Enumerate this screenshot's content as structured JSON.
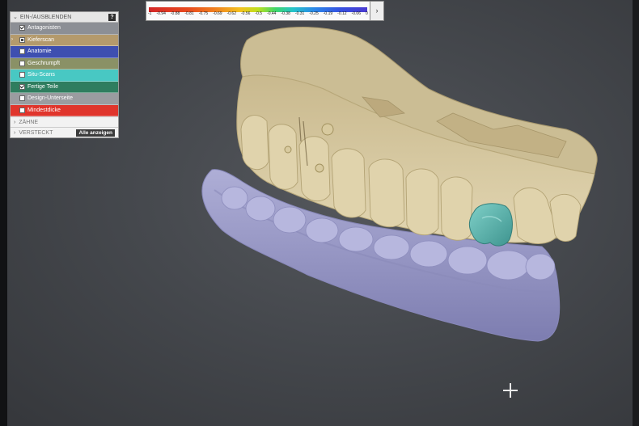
{
  "panel": {
    "title": "EIN-/AUSBLENDEN",
    "help": "?",
    "layers": [
      {
        "label": "Antagonisten",
        "color": "#8c8f95",
        "state": "checked",
        "expandable": false
      },
      {
        "label": "Kieferscan",
        "color": "#b49a6c",
        "state": "partial",
        "expandable": true
      },
      {
        "label": "Anatomie",
        "color": "#3e4fb0",
        "state": "unchecked",
        "expandable": false
      },
      {
        "label": "Geschrumpft",
        "color": "#8a9166",
        "state": "unchecked",
        "expandable": false
      },
      {
        "label": "Situ-Scans",
        "color": "#48c8c3",
        "state": "unchecked",
        "expandable": false
      },
      {
        "label": "Fertige Teile",
        "color": "#2f7d5f",
        "state": "checked",
        "expandable": false
      },
      {
        "label": "Design-Unterseite",
        "color": "#9a9ca0",
        "state": "unchecked",
        "expandable": false
      },
      {
        "label": "Mindestdicke",
        "color": "#e0352c",
        "state": "unchecked",
        "expandable": false
      }
    ],
    "teeth_section": "ZÄHNE",
    "hidden_section": "VERSTECKT",
    "show_all": "Alle anzeigen"
  },
  "color_scale": {
    "labels": [
      "-1",
      "-0.94",
      "-0.88",
      "-0.81",
      "-0.75",
      "-0.69",
      "-0.62",
      "-0.56",
      "-0.5",
      "-0.44",
      "-0.38",
      "-0.31",
      "-0.25",
      "-0.19",
      "-0.12",
      "-0.06",
      "0"
    ],
    "expand_icon": "›"
  },
  "viewport": {
    "upper_jaw_color": "#d8c9a1",
    "lower_jaw_color": "#9a9ac6",
    "crown_color": "#5fb5b0"
  }
}
